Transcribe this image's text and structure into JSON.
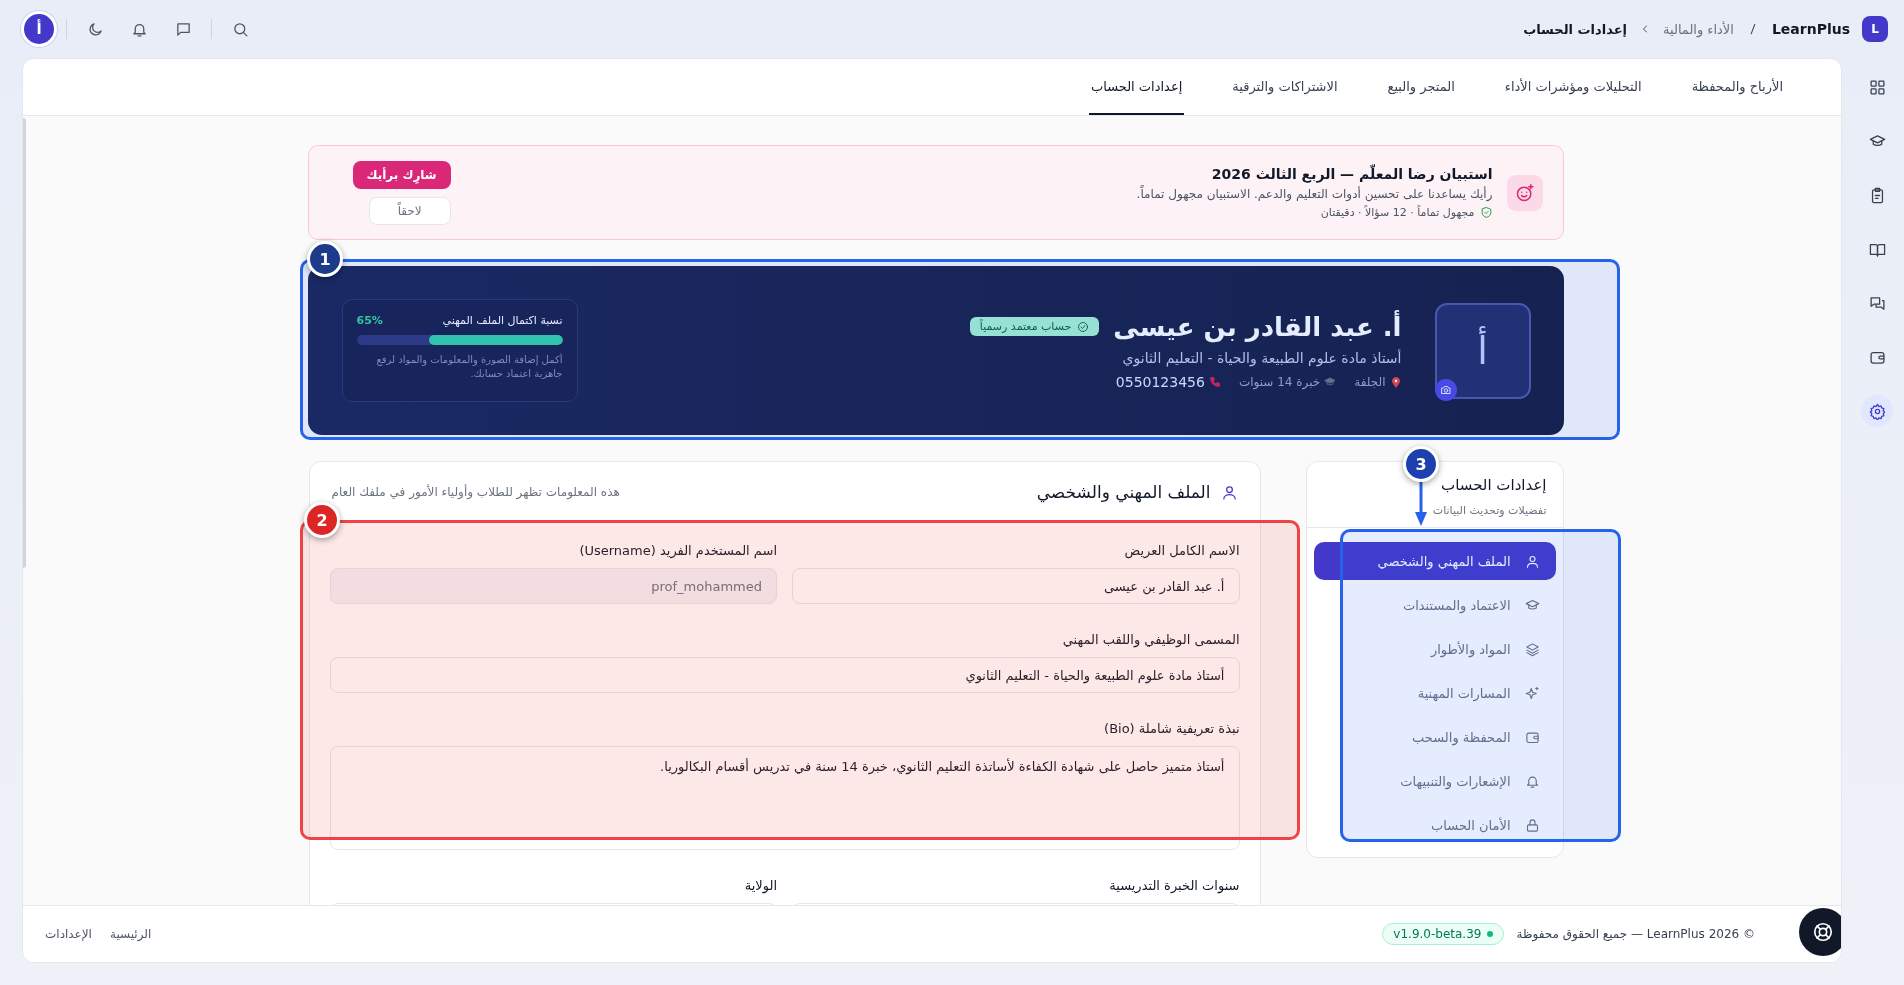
{
  "topbar": {
    "logo_letter": "L",
    "brand": "LearnPlus",
    "breadcrumbs": [
      {
        "label": "الأداء والمالية",
        "current": false
      },
      {
        "label": "إعدادات الحساب",
        "current": true
      }
    ],
    "avatar_letter": "أ"
  },
  "rail": [
    {
      "selected": false
    },
    {
      "selected": false
    },
    {
      "selected": false
    },
    {
      "selected": false
    },
    {
      "selected": false
    },
    {
      "selected": false
    },
    {
      "selected": true
    }
  ],
  "tabs": [
    {
      "label": "الأرباح والمحفظة",
      "selected": false
    },
    {
      "label": "التحليلات ومؤشرات الأداء",
      "selected": false
    },
    {
      "label": "المتجر والبيع",
      "selected": false
    },
    {
      "label": "الاشتراكات والترقية",
      "selected": false
    },
    {
      "label": "إعدادات الحساب",
      "selected": true
    }
  ],
  "survey": {
    "title": "استبيان رضا المعلّم — الربع الثالث 2026",
    "description": "رأيك يساعدنا على تحسين أدوات التعليم والدعم. الاستبيان مجهول تماماً.",
    "meta": "مجهول تماماً · 12 سؤالاً · دقيقتان",
    "primary_button": "شارِك برأيك",
    "secondary_button": "لاحقاً"
  },
  "profile": {
    "avatar_letter": "أ",
    "name": "أ. عبد القادر بن عيسى",
    "badge": "حساب معتمد رسمياً",
    "subtitle": "أستاذ مادة علوم الطبيعة والحياة - التعليم الثانوي",
    "location": "الجلفة",
    "experience": "خبرة 14 سنوات",
    "phone": "0550123456",
    "completion": {
      "label": "نسبة اكتمال الملف المهني",
      "percent": "65%",
      "level": 0.65,
      "note": "أكمل إضافة الصورة والمعلومات والمواد لرفع جاهزية اعتماد حسابك."
    }
  },
  "settings_nav": {
    "title": "إعدادات الحساب",
    "subtitle": "تفضيلات وتحديث البيانات",
    "items": [
      {
        "label": "الملف المهني والشخصي",
        "selected": true
      },
      {
        "label": "الاعتماد والمستندات",
        "selected": false
      },
      {
        "label": "المواد والأطوار",
        "selected": false
      },
      {
        "label": "المسارات المهنية",
        "selected": false
      },
      {
        "label": "المحفظة والسحب",
        "selected": false
      },
      {
        "label": "الإشعارات والتنبيهات",
        "selected": false
      },
      {
        "label": "الأمان الحساب",
        "selected": false
      }
    ]
  },
  "form": {
    "title": "الملف المهني والشخصي",
    "hint": "هذه المعلومات تظهر للطلاب وأولياء الأمور في ملفك العام",
    "fields": [
      {
        "kind": "input",
        "label": "الاسم الكامل العريض",
        "value": "أ. عبد القادر بن عيسى",
        "wide": false,
        "disabled": false
      },
      {
        "kind": "input",
        "label": "اسم المستخدم الفريد (Username)",
        "value": "prof_mohammed",
        "wide": false,
        "disabled": true
      },
      {
        "kind": "input",
        "label": "المسمى الوظيفي واللقب المهني",
        "value": "أستاذ مادة علوم الطبيعة والحياة - التعليم الثانوي",
        "wide": true,
        "disabled": false
      },
      {
        "kind": "textarea",
        "label": "نبذة تعريفية شاملة (Bio)",
        "value": "أستاذ متميز حاصل على شهادة الكفاءة لأساتذة التعليم الثانوي، خبرة 14 سنة في تدريس أقسام البكالوريا.",
        "wide": true,
        "disabled": false
      },
      {
        "kind": "input",
        "label": "سنوات الخبرة التدريسية",
        "wide": false,
        "disabled": false
      },
      {
        "kind": "input",
        "label": "الولاية",
        "wide": false,
        "disabled": false
      }
    ]
  },
  "footer": {
    "copyright": "© 2026 LearnPlus — جميع الحقوق محفوظة",
    "version": "v1.9.0-beta.39",
    "links": [
      "الرئيسية",
      "الإعدادات"
    ]
  },
  "annotations": [
    {
      "number": "1",
      "color": "#2563eb",
      "arrow": false
    },
    {
      "number": "2",
      "color": "#ef4444",
      "arrow": false
    },
    {
      "number": "3",
      "color": "#2563eb",
      "arrow": true
    }
  ]
}
